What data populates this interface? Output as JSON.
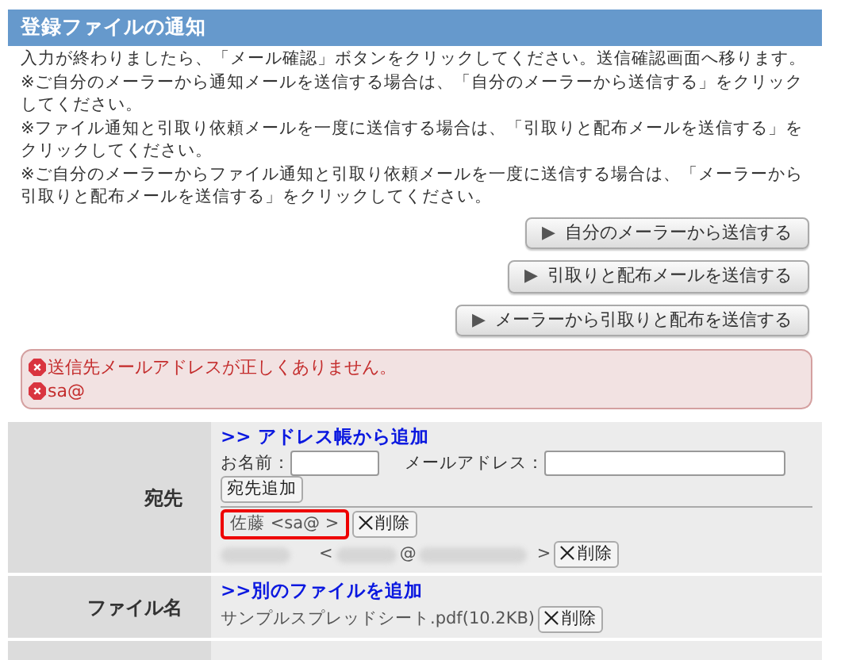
{
  "panel": {
    "title": "登録ファイルの通知"
  },
  "instructions": [
    "入力が終わりましたら、「メール確認」ボタンをクリックしてください。送信確認画面へ移ります。",
    "※ご自分のメーラーから通知メールを送信する場合は、「自分のメーラーから送信する」をクリックしてください。",
    "※ファイル通知と引取り依頼メールを一度に送信する場合は、「引取りと配布メールを送信する」をクリックしてください。",
    "※ご自分のメーラーからファイル通知と引取り依頼メールを一度に送信する場合は、「メーラーから引取りと配布メールを送信する」をクリックしてください。"
  ],
  "buttons": [
    {
      "icon": "▶",
      "label": "自分のメーラーから送信する"
    },
    {
      "icon": "▶",
      "label": "引取りと配布メールを送信する"
    },
    {
      "icon": "▶",
      "label": "メーラーから引取りと配布を送信する"
    }
  ],
  "errors": [
    "送信先メールアドレスが正しくありません。",
    "sa@"
  ],
  "recipients": {
    "label": "宛先",
    "add_link": ">> アドレス帳から追加",
    "name_label": "お名前：",
    "email_label": "メールアドレス：",
    "add_button": "宛先追加",
    "entries": [
      {
        "kind": "plain",
        "text": "佐藤 <sa@ >",
        "invalid": true,
        "delete": "削除"
      },
      {
        "kind": "redacted",
        "open": "<",
        "at": "@",
        "close": ">",
        "delete": "削除"
      }
    ]
  },
  "files": {
    "label": "ファイル名",
    "add_link": ">>別のファイルを追加",
    "items": [
      {
        "name": "サンプルスプレッドシート.pdf(10.2KB)",
        "delete": "削除"
      }
    ]
  }
}
